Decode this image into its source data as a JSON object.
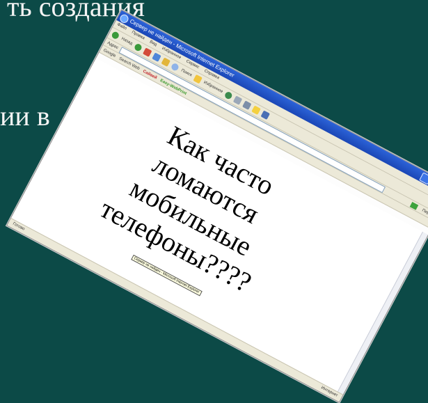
{
  "slide": {
    "bg_line_top": "ть создания",
    "bg_line_mid": "ии в",
    "background_color": "#0c4a47"
  },
  "question_lines": [
    "Как часто",
    "ломаются",
    "мобильные",
    "телефоны????"
  ],
  "browser": {
    "title": "Сервер не найден - Microsoft Internet Explorer",
    "menu": [
      "Файл",
      "Правка",
      "Вид",
      "Избранное",
      "Сервис",
      "Справка"
    ],
    "toolbar": [
      "Назад",
      "Поиск",
      "Избранное"
    ],
    "address_label": "Адрес",
    "go_label": "Переход",
    "links": {
      "google": "Google",
      "search": "Search Web",
      "brand_red": "Сайвей",
      "brand_green": "Easy-WebPrint"
    },
    "status_left": "Готово",
    "status_right": "Интернет",
    "tooltip": "Сервер не найден - Microsoft Internet Explorer"
  }
}
